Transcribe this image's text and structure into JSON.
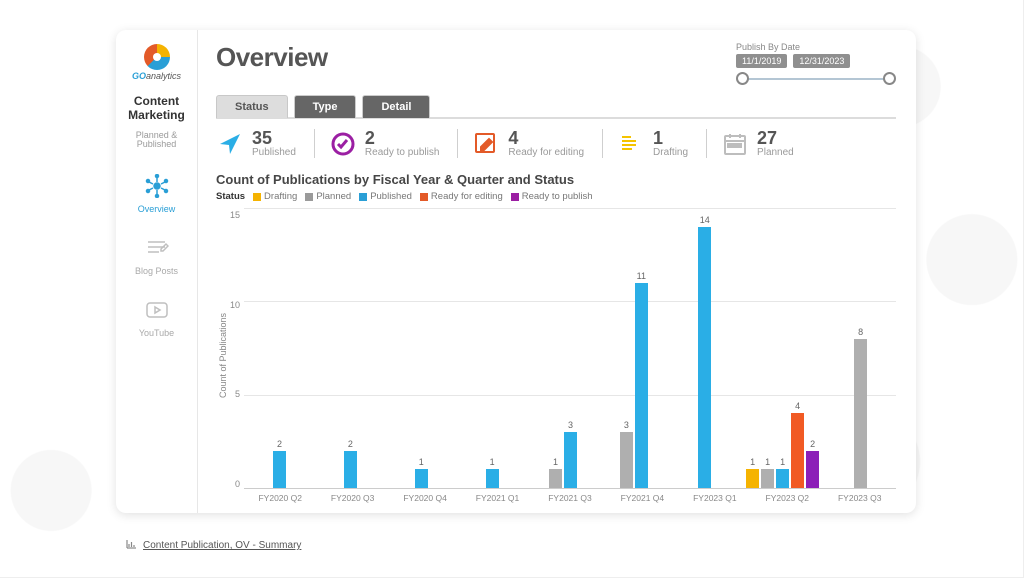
{
  "app": {
    "logo_text": "GOanalytics",
    "header_title": "Overview",
    "section_title": "Content Marketing",
    "section_subtitle": "Planned & Published"
  },
  "sidebar": {
    "items": [
      {
        "name": "overview",
        "label": "Overview",
        "active": true
      },
      {
        "name": "blog-posts",
        "label": "Blog Posts",
        "active": false
      },
      {
        "name": "youtube",
        "label": "YouTube",
        "active": false
      }
    ]
  },
  "date_range": {
    "label": "Publish By Date",
    "from": "11/1/2019",
    "to": "12/31/2023"
  },
  "tabs": [
    {
      "name": "status",
      "label": "Status",
      "active": true
    },
    {
      "name": "type",
      "label": "Type",
      "active": false
    },
    {
      "name": "detail",
      "label": "Detail",
      "active": false
    }
  ],
  "kpis": [
    {
      "name": "published",
      "value": "35",
      "label": "Published",
      "color": "#2a9fd6"
    },
    {
      "name": "ready-to-publish",
      "value": "2",
      "label": "Ready to publish",
      "color": "#9b1fa3"
    },
    {
      "name": "ready-for-editing",
      "value": "4",
      "label": "Ready for editing",
      "color": "#e35a28"
    },
    {
      "name": "drafting",
      "value": "1",
      "label": "Drafting",
      "color": "#f5b301"
    },
    {
      "name": "planned",
      "value": "27",
      "label": "Planned",
      "color": "#9a9a9a"
    }
  ],
  "legend": {
    "label": "Status",
    "items": [
      {
        "name": "Drafting",
        "color": "#f5b301"
      },
      {
        "name": "Planned",
        "color": "#9a9a9a"
      },
      {
        "name": "Published",
        "color": "#2a9fd6"
      },
      {
        "name": "Ready for editing",
        "color": "#e35a28"
      },
      {
        "name": "Ready to publish",
        "color": "#9b1fa3"
      }
    ]
  },
  "chart_data": {
    "type": "bar",
    "title": "Count of Publications by Fiscal Year & Quarter and Status",
    "ylabel": "Count of Publications",
    "ylim": [
      0,
      15
    ],
    "yticks": [
      0,
      5,
      10,
      15
    ],
    "categories": [
      "FY2020 Q2",
      "FY2020 Q3",
      "FY2020 Q4",
      "FY2021 Q1",
      "FY2021 Q3",
      "FY2021 Q4",
      "FY2023 Q1",
      "FY2023 Q2",
      "FY2023 Q3"
    ],
    "series": [
      {
        "name": "Drafting",
        "color": "#f5b301",
        "values": [
          0,
          0,
          0,
          0,
          0,
          0,
          0,
          1,
          0
        ]
      },
      {
        "name": "Planned",
        "color": "#afafaf",
        "values": [
          0,
          0,
          0,
          0,
          1,
          3,
          0,
          1,
          8
        ]
      },
      {
        "name": "Published",
        "color": "#2aaee6",
        "values": [
          2,
          2,
          1,
          1,
          3,
          11,
          14,
          1,
          0
        ]
      },
      {
        "name": "Ready for editing",
        "color": "#f15a24",
        "values": [
          0,
          0,
          0,
          0,
          0,
          0,
          0,
          4,
          0
        ]
      },
      {
        "name": "Ready to publish",
        "color": "#8c1fb8",
        "values": [
          0,
          0,
          0,
          0,
          0,
          0,
          0,
          2,
          0
        ]
      }
    ],
    "max": 15
  },
  "footer": {
    "link_text": "Content Publication, OV - Summary"
  }
}
